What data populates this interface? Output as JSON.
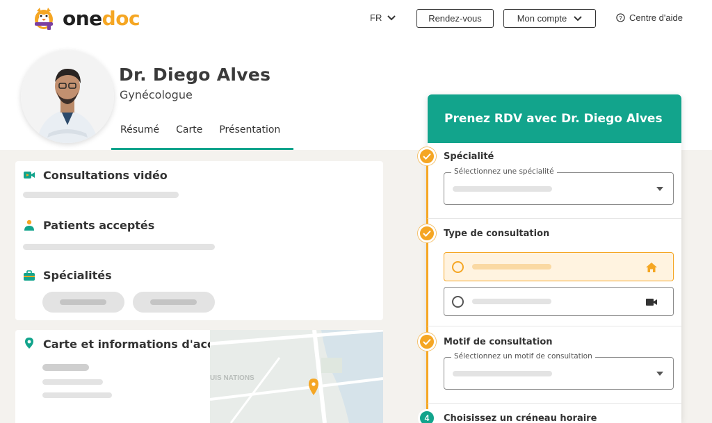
{
  "brand": {
    "name_part1": "one",
    "name_part2": "doc"
  },
  "nav": {
    "language": "FR",
    "appointments_label": "Rendez-vous",
    "account_label": "Mon compte",
    "help_label": "Centre d'aide"
  },
  "doctor": {
    "name": "Dr. Diego Alves",
    "specialty": "Gynécologue"
  },
  "tabs": [
    {
      "label": "Résumé"
    },
    {
      "label": "Carte"
    },
    {
      "label": "Présentation"
    }
  ],
  "sections": {
    "video": "Consultations vidéo",
    "patients": "Patients acceptés",
    "specialties": "Spécialités",
    "map": "Carte et informations d'accès"
  },
  "booking": {
    "title": "Prenez RDV avec Dr. Diego Alves",
    "steps": [
      {
        "title": "Spécialité",
        "select_label": "Sélectionnez une spécialité"
      },
      {
        "title": "Type de consultation"
      },
      {
        "title": "Motif de consultation",
        "select_label": "Sélectionnez un motif de consultation"
      },
      {
        "number": "4",
        "title": "Choisissez un créneau horaire"
      }
    ]
  },
  "map_labels": {
    "district": "UIS NATIONS"
  },
  "colors": {
    "accent": "#12a48c",
    "secondary": "#f5a623"
  }
}
